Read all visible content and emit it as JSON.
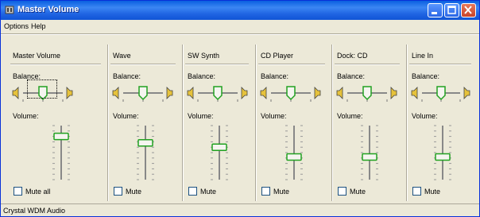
{
  "window": {
    "title": "Master Volume",
    "icon": "speaker-icon",
    "controls": [
      "minimize-icon",
      "maximize-icon",
      "close-icon"
    ]
  },
  "menu": {
    "items": [
      "Options",
      "Help"
    ]
  },
  "common": {
    "balance_label": "Balance:",
    "volume_label": "Volume:"
  },
  "columns": [
    {
      "title": "Master Volume",
      "mute_label": "Mute all",
      "balance": 0.5,
      "volume": 0.8
    },
    {
      "title": "Wave",
      "mute_label": "Mute",
      "balance": 0.5,
      "volume": 0.68
    },
    {
      "title": "SW Synth",
      "mute_label": "Mute",
      "balance": 0.5,
      "volume": 0.6
    },
    {
      "title": "CD Player",
      "mute_label": "Mute",
      "balance": 0.5,
      "volume": 0.42
    },
    {
      "title": "Dock: CD",
      "mute_label": "Mute",
      "balance": 0.5,
      "volume": 0.42
    },
    {
      "title": "Line In",
      "mute_label": "Mute",
      "balance": 0.5,
      "volume": 0.42
    }
  ],
  "status": {
    "text": "Crystal WDM Audio"
  },
  "colors": {
    "titlebar": "#0a5fe0",
    "thumb_green": "#21a121",
    "face": "#ece9d8"
  }
}
